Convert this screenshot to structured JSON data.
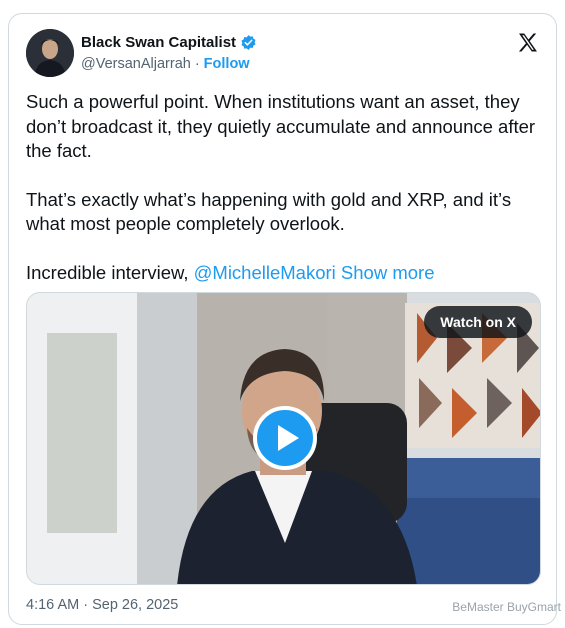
{
  "author": {
    "display_name": "Black Swan Capitalist",
    "handle": "@VersanAljarrah",
    "separator": "·",
    "follow_label": "Follow"
  },
  "tweet": {
    "paragraph1": "Such a powerful point. When institutions want an asset, they don’t broadcast it, they quietly accumulate and announce after the fact.",
    "paragraph2": "That’s exactly what’s happening with gold and XRP, and it’s what most people completely overlook.",
    "paragraph3_prefix": "Incredible interview, ",
    "mention": "@MichelleMakori",
    "show_more": "Show more"
  },
  "media": {
    "watch_label": "Watch on X"
  },
  "timestamp": "4:16 AM · Sep 26, 2025",
  "watermark": "BeMaster BuyGmart",
  "icons": {
    "verified": "verified-badge-icon",
    "logo": "x-logo-icon",
    "play": "play-icon"
  },
  "colors": {
    "accent": "#1d9bf0",
    "text": "#0f1419",
    "muted": "#536471"
  }
}
